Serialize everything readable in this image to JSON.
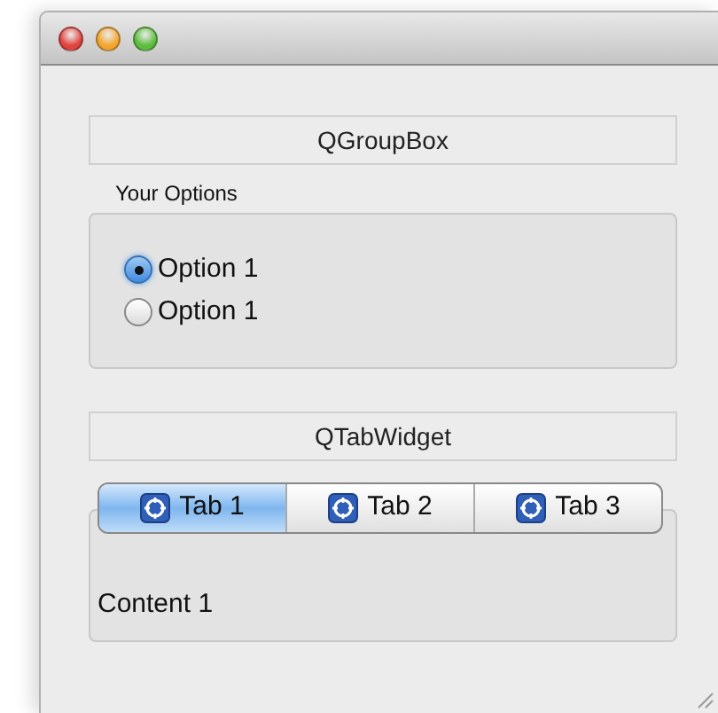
{
  "group_box": {
    "header": "QGroupBox",
    "title": "Your Options",
    "options": [
      {
        "label": "Option 1",
        "selected": true
      },
      {
        "label": "Option 1",
        "selected": false
      }
    ]
  },
  "tab_widget": {
    "header": "QTabWidget",
    "tabs": [
      {
        "label": "Tab 1",
        "selected": true
      },
      {
        "label": "Tab 2",
        "selected": false
      },
      {
        "label": "Tab 3",
        "selected": false
      }
    ],
    "content": "Content 1"
  }
}
